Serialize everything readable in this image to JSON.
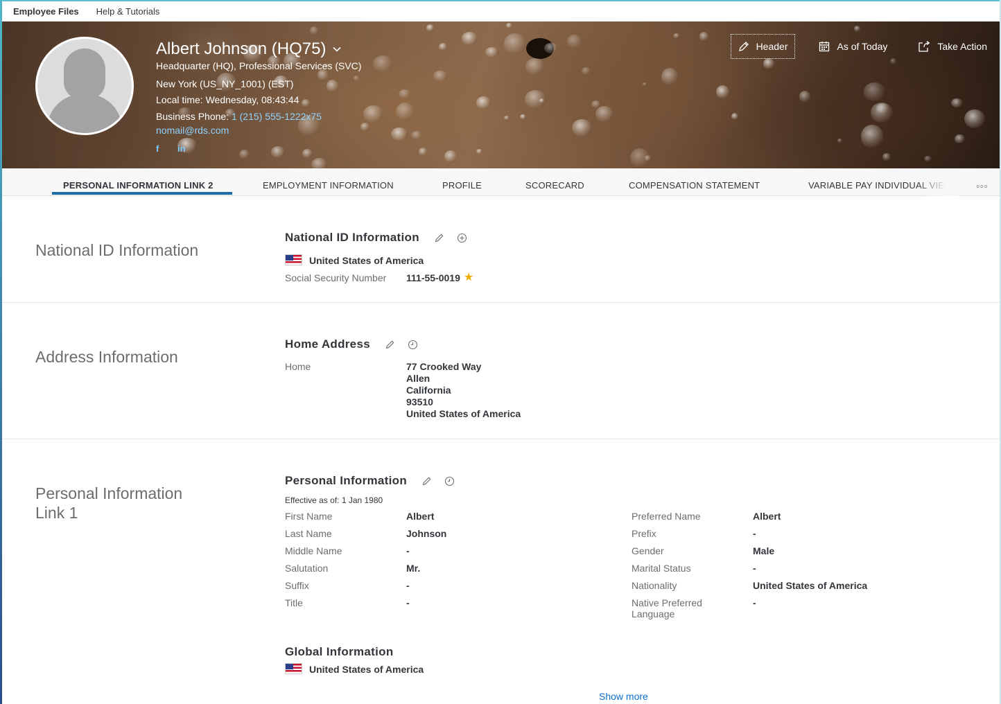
{
  "topnav": {
    "items": [
      {
        "label": "Employee Files",
        "active": true
      },
      {
        "label": "Help & Tutorials",
        "active": false
      }
    ]
  },
  "header": {
    "name": "Albert Johnson (HQ75)",
    "department": "Headquarter (HQ), Professional Services (SVC)",
    "location": "New York (US_NY_1001) (EST)",
    "local_time": "Local time: Wednesday, 08:43:44",
    "phone_label": "Business Phone: ",
    "phone": "1 (215) 555-1222x75",
    "email": "nomail@rds.com",
    "social": {
      "facebook": "f",
      "linkedin": "in"
    },
    "actions": {
      "header": "Header",
      "as_of": "As of Today",
      "take_action": "Take Action"
    }
  },
  "tabs": [
    {
      "label": "PERSONAL INFORMATION LINK 2",
      "active": true
    },
    {
      "label": "EMPLOYMENT INFORMATION",
      "active": false
    },
    {
      "label": "PROFILE",
      "active": false
    },
    {
      "label": "SCORECARD",
      "active": false
    },
    {
      "label": "COMPENSATION STATEMENT",
      "active": false
    },
    {
      "label": "VARIABLE PAY INDIVIDUAL VIEW",
      "active": false
    }
  ],
  "tabs_more": "◦◦◦",
  "national_id": {
    "section_title": "National ID Information",
    "block_title": "National ID Information",
    "country": "United States of America",
    "ssn_label": "Social Security Number",
    "ssn_value": "111-55-0019"
  },
  "address": {
    "section_title": "Address Information",
    "block_title": "Home Address",
    "type_label": "Home",
    "lines": [
      "77 Crooked Way",
      "Allen",
      "California",
      "93510",
      "United States of America"
    ]
  },
  "personal": {
    "section_title_line1": "Personal Information",
    "section_title_line2": "Link 1",
    "block_title": "Personal Information",
    "effective": "Effective as of: 1 Jan 1980",
    "left_fields": [
      {
        "label": "First Name",
        "value": "Albert"
      },
      {
        "label": "Last Name",
        "value": "Johnson"
      },
      {
        "label": "Middle Name",
        "value": "-"
      },
      {
        "label": "Salutation",
        "value": "Mr."
      },
      {
        "label": "Suffix",
        "value": "-"
      },
      {
        "label": "Title",
        "value": "-"
      }
    ],
    "right_fields": [
      {
        "label": "Preferred Name",
        "value": "Albert"
      },
      {
        "label": "Prefix",
        "value": "-"
      },
      {
        "label": "Gender",
        "value": "Male"
      },
      {
        "label": "Marital Status",
        "value": "-"
      },
      {
        "label": "Nationality",
        "value": "United States of America"
      },
      {
        "label": "Native Preferred",
        "label2": "Language",
        "value": "-"
      }
    ],
    "global_title": "Global Information",
    "global_country": "United States of America",
    "show_more": "Show more"
  },
  "icons": {
    "edit": "pencil-icon",
    "add": "circle-plus-icon",
    "history": "clock-icon",
    "star": "star-icon",
    "calendar": "calendar-icon",
    "share": "external-action-icon"
  },
  "colors": {
    "accent": "#1b6da8",
    "link": "#0a6ed1",
    "star": "#f0ab00"
  }
}
